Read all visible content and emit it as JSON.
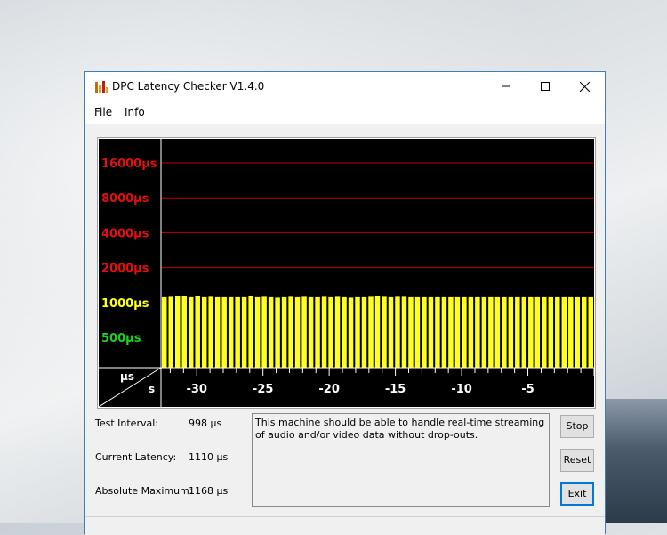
{
  "window": {
    "title": "DPC Latency Checker V1.4.0",
    "controls": {
      "minimize": "—",
      "maximize": "☐",
      "close": "✕"
    }
  },
  "menu": {
    "items": [
      "File",
      "Info"
    ]
  },
  "chart_data": {
    "type": "bar",
    "y_tick_labels": [
      "16000µs",
      "8000µs",
      "4000µs",
      "2000µs",
      "1000µs",
      "500µs"
    ],
    "y_tick_values": [
      16000,
      8000,
      4000,
      2000,
      1000,
      500
    ],
    "y_tick_colors": [
      "#e01010",
      "#e01010",
      "#e01010",
      "#e01010",
      "#ffff20",
      "#20d020"
    ],
    "y_gridlines": [
      16000,
      8000,
      4000,
      2000
    ],
    "y_scale": "log",
    "axis_corner": {
      "top": "µs",
      "bottom": "s"
    },
    "x_tick_labels": [
      "-30",
      "-25",
      "-20",
      "-15",
      "-10",
      "-5"
    ],
    "x_tick_values": [
      -30,
      -25,
      -20,
      -15,
      -10,
      -5
    ],
    "x_range": [
      -32.7,
      0
    ],
    "bar_color": "#ffff20",
    "grid_color": "#c00000",
    "background": "#000000",
    "values": [
      1110,
      1120,
      1130,
      1130,
      1110,
      1130,
      1110,
      1120,
      1110,
      1110,
      1110,
      1110,
      1110,
      1140,
      1110,
      1120,
      1110,
      1100,
      1110,
      1120,
      1110,
      1120,
      1110,
      1110,
      1120,
      1110,
      1120,
      1110,
      1100,
      1110,
      1110,
      1120,
      1130,
      1120,
      1110,
      1120,
      1120,
      1110,
      1110,
      1110,
      1110,
      1110,
      1110,
      1110,
      1110,
      1110,
      1110,
      1110,
      1110,
      1110,
      1110,
      1110,
      1110,
      1110,
      1110,
      1110,
      1110,
      1110,
      1110,
      1110,
      1110,
      1110,
      1110,
      1110,
      1110
    ]
  },
  "stats": {
    "test_interval": {
      "label": "Test Interval:",
      "value": "998 µs"
    },
    "current_latency": {
      "label": "Current Latency:",
      "value": "1110 µs"
    },
    "absolute_maximum": {
      "label": "Absolute Maximum:",
      "value": "1168 µs"
    }
  },
  "message": "This machine should be able to handle real-time streaming of audio and/or video data without drop-outs.",
  "buttons": {
    "stop": "Stop",
    "reset": "Reset",
    "exit": "Exit"
  }
}
